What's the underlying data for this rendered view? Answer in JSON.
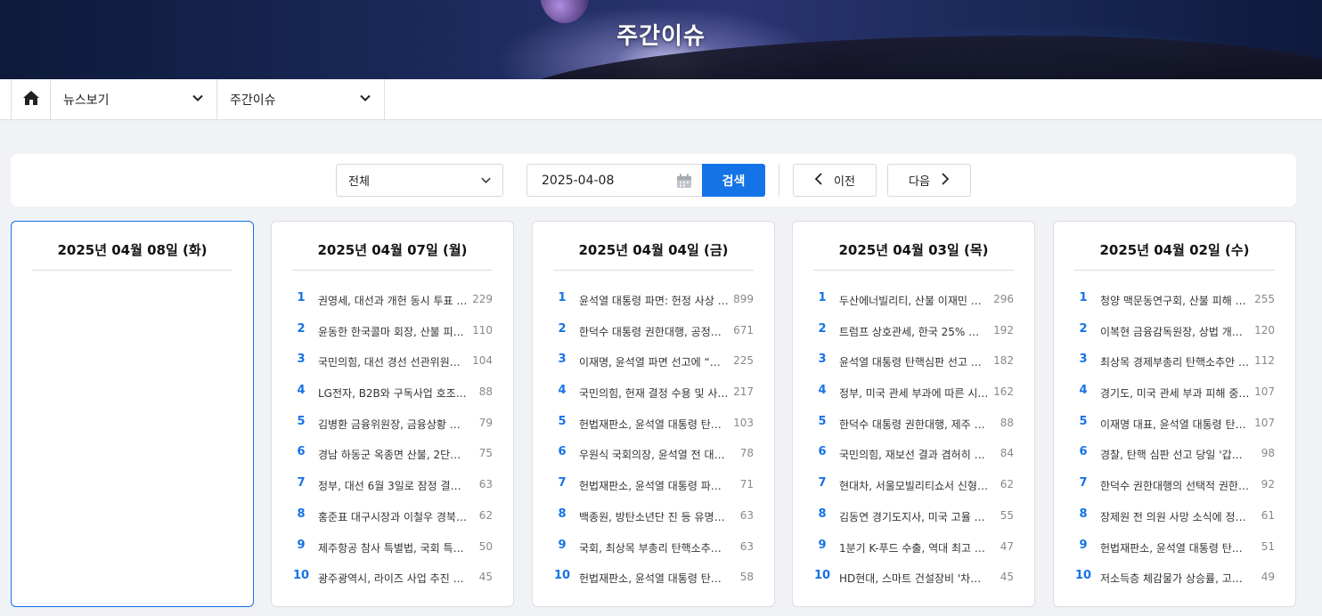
{
  "banner": {
    "title": "주간이슈"
  },
  "nav": {
    "home_icon": "home-icon",
    "dropdown1": "뉴스보기",
    "dropdown2": "주간이슈"
  },
  "search": {
    "category": "전체",
    "date": "2025-04-08",
    "search_label": "검색",
    "prev_label": "이전",
    "next_label": "다음"
  },
  "colors": {
    "accent": "#1473e6",
    "page_bg": "#f1f2f5"
  },
  "days": [
    {
      "date": "2025년 04월 08일 (화)",
      "active": true,
      "items": []
    },
    {
      "date": "2025년 04월 07일 (월)",
      "items": [
        {
          "rank": "1",
          "title": "권영세, 대선과 개헌 동시 투표 …",
          "count": "229"
        },
        {
          "rank": "2",
          "title": "윤동한 한국콜마 회장, 산불 피해 …",
          "count": "110"
        },
        {
          "rank": "3",
          "title": "국민의힘, 대선 경선 선관위원장…",
          "count": "104"
        },
        {
          "rank": "4",
          "title": "LG전자, B2B와 구독사업 호조로 …",
          "count": "88"
        },
        {
          "rank": "5",
          "title": "김병환 금융위원장, 금융상황 점검…",
          "count": "79"
        },
        {
          "rank": "6",
          "title": "경남 하동군 옥종면 산불, 2단계 …",
          "count": "75"
        },
        {
          "rank": "7",
          "title": "정부, 대선 6월 3일로 잠정 결정……",
          "count": "63"
        },
        {
          "rank": "8",
          "title": "홍준표 대구시장과 이철우 경북도…",
          "count": "62"
        },
        {
          "rank": "9",
          "title": "제주항공 참사 특별법, 국회 특위 …",
          "count": "50"
        },
        {
          "rank": "10",
          "title": "광주광역시, 라이즈 사업 추진 대…",
          "count": "45"
        }
      ]
    },
    {
      "date": "2025년 04월 04일 (금)",
      "items": [
        {
          "rank": "1",
          "title": "윤석열 대통령 파면: 헌정 사상 …",
          "count": "899"
        },
        {
          "rank": "2",
          "title": "한덕수 대통령 권한대행, 공정하…",
          "count": "671"
        },
        {
          "rank": "3",
          "title": "이재명, 윤석열 파면 선고에 “이…",
          "count": "225"
        },
        {
          "rank": "4",
          "title": "국민의힘, 헌재 결정 수용 및 사과…",
          "count": "217"
        },
        {
          "rank": "5",
          "title": "헌법재판소, 윤석열 대통령 탄핵 …",
          "count": "103"
        },
        {
          "rank": "6",
          "title": "우원식 국회의장, 윤석열 전 대통…",
          "count": "78"
        },
        {
          "rank": "7",
          "title": "헌법재판소, 윤석열 대통령 파면 결…",
          "count": "71"
        },
        {
          "rank": "8",
          "title": "백종원, 방탄소년단 진 등 유명인…",
          "count": "63"
        },
        {
          "rank": "9",
          "title": "국회, 최상목 부총리 탄핵소추안 …",
          "count": "63"
        },
        {
          "rank": "10",
          "title": "헌법재판소, 윤석열 대통령 탄핵심…",
          "count": "58"
        }
      ]
    },
    {
      "date": "2025년 04월 03일 (목)",
      "items": [
        {
          "rank": "1",
          "title": "두산에너빌리티, 산불 이재민 지…",
          "count": "296"
        },
        {
          "rank": "2",
          "title": "트럼프 상호관세, 한국 25% 발…",
          "count": "192"
        },
        {
          "rank": "3",
          "title": "윤석열 대통령 탄핵심판 선고 임…",
          "count": "182"
        },
        {
          "rank": "4",
          "title": "정부, 미국 관세 부과에 따른 시…",
          "count": "162"
        },
        {
          "rank": "5",
          "title": "한덕수 대통령 권한대행, 제주 4·3…",
          "count": "88"
        },
        {
          "rank": "6",
          "title": "국민의힘, 재보선 결과 겸허히 받…",
          "count": "84"
        },
        {
          "rank": "7",
          "title": "현대차, 서울모빌리티쇼서 신형 수…",
          "count": "62"
        },
        {
          "rank": "8",
          "title": "김동연 경기도지사, 미국 고율 관…",
          "count": "55"
        },
        {
          "rank": "9",
          "title": "1분기 K-푸드 수출, 역대 최고 기…",
          "count": "47"
        },
        {
          "rank": "10",
          "title": "HD현대, 스마트 건설장비 '차세대…",
          "count": "45"
        }
      ]
    },
    {
      "date": "2025년 04월 02일 (수)",
      "items": [
        {
          "rank": "1",
          "title": "청양 맥문동연구회, 산불 피해 지…",
          "count": "255"
        },
        {
          "rank": "2",
          "title": "이복현 금융감독원장, 상법 개정…",
          "count": "120"
        },
        {
          "rank": "3",
          "title": "최상목 경제부총리 탄핵소추안 국…",
          "count": "112"
        },
        {
          "rank": "4",
          "title": "경기도, 미국 관세 부과 피해 중소…",
          "count": "107"
        },
        {
          "rank": "5",
          "title": "이재명 대표, 윤석열 대통령 탄핵…",
          "count": "107"
        },
        {
          "rank": "6",
          "title": "경찰, 탄핵 심판 선고 당일 '갑호 …",
          "count": "98"
        },
        {
          "rank": "7",
          "title": "한덕수 권한대행의 선택적 권한 행…",
          "count": "92"
        },
        {
          "rank": "8",
          "title": "장제원 전 의원 사망 소식에 정치…",
          "count": "61"
        },
        {
          "rank": "9",
          "title": "헌법재판소, 윤석열 대통령 탄핵심…",
          "count": "51"
        },
        {
          "rank": "10",
          "title": "저소득층 체감물가 상승률, 고소…",
          "count": "49"
        }
      ]
    }
  ]
}
